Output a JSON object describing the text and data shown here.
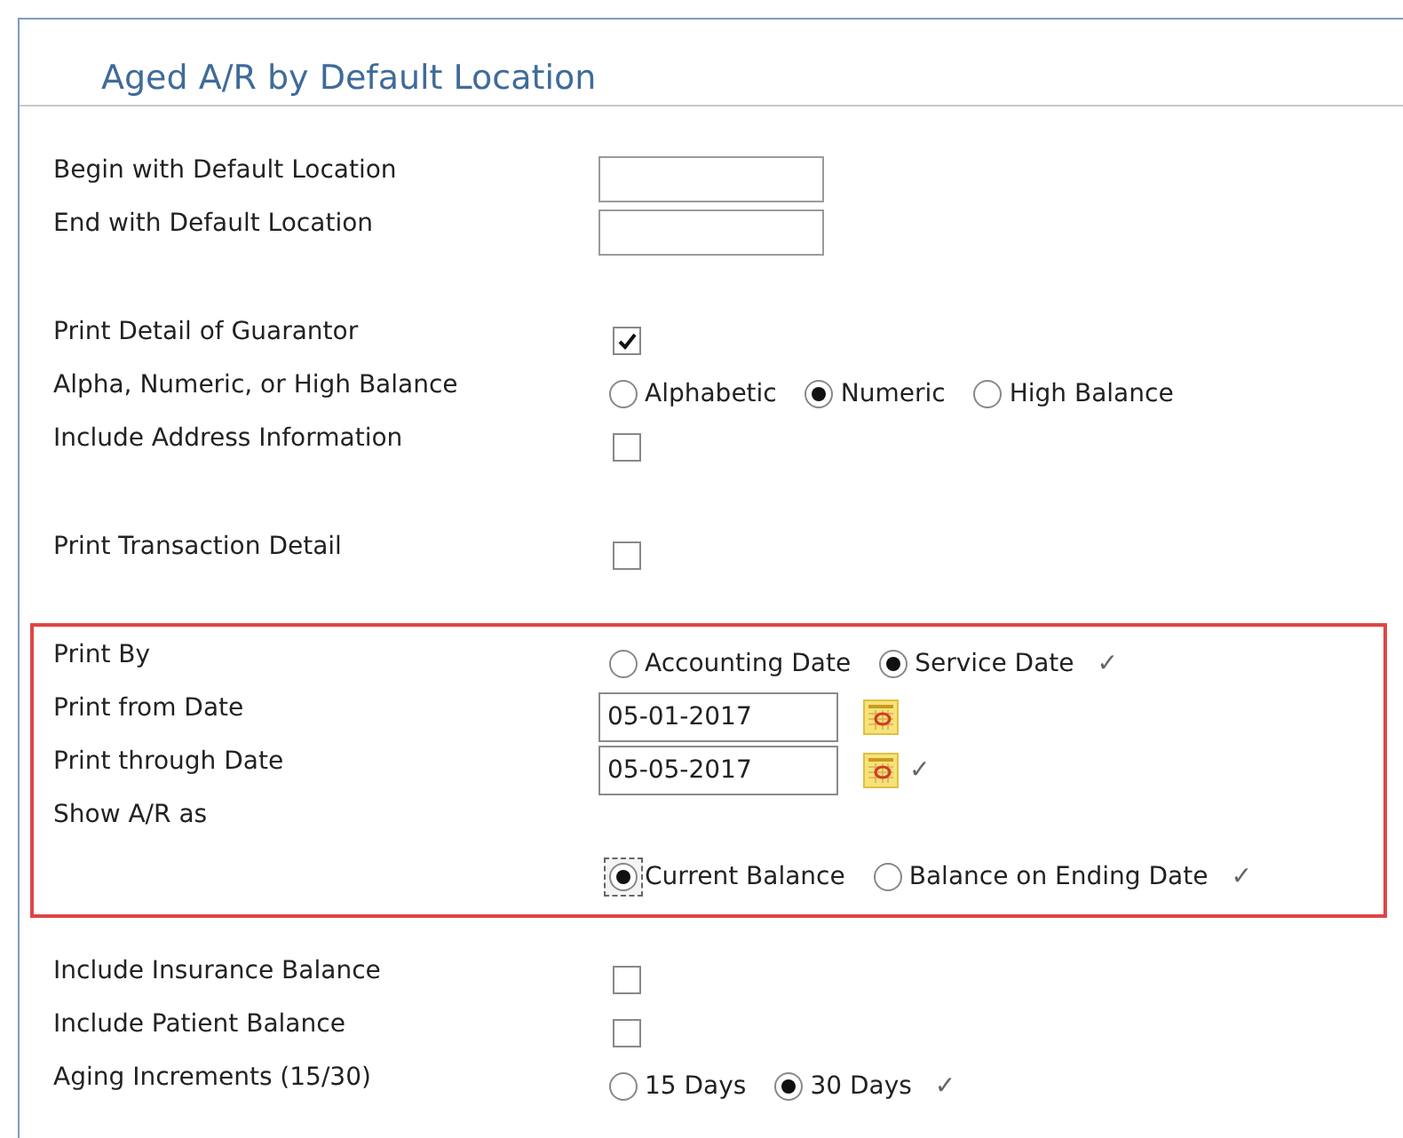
{
  "title": "Aged A/R by Default Location",
  "sections": [
    {
      "kind": "plain",
      "rows": [
        {
          "kind": "text",
          "label": "Begin with Default Location",
          "value": ""
        },
        {
          "kind": "text",
          "label": "End with Default Location",
          "value": ""
        }
      ]
    },
    {
      "kind": "plain",
      "rows": [
        {
          "kind": "checkbox",
          "label": "Print Detail of Guarantor",
          "checked": true
        },
        {
          "kind": "radio",
          "label": "Alpha, Numeric, or High Balance",
          "options": [
            {
              "label": "Alphabetic",
              "selected": false,
              "focused": false
            },
            {
              "label": "Numeric",
              "selected": true,
              "focused": false
            },
            {
              "label": "High Balance",
              "selected": false,
              "focused": false
            }
          ]
        },
        {
          "kind": "checkbox",
          "label": "Include Address Information",
          "checked": false
        }
      ]
    },
    {
      "kind": "plain",
      "rows": [
        {
          "kind": "checkbox",
          "label": "Print Transaction Detail",
          "checked": false
        }
      ]
    },
    {
      "kind": "highlighted",
      "rows": [
        {
          "kind": "radio",
          "label": "Print By",
          "options": [
            {
              "label": "Accounting Date",
              "selected": false,
              "focused": false
            },
            {
              "label": "Service Date",
              "selected": true,
              "focused": false
            }
          ],
          "mark": "✓"
        },
        {
          "kind": "date",
          "label": "Print from Date",
          "value": "05-01-2017"
        },
        {
          "kind": "date",
          "label": "Print through Date",
          "value": "05-05-2017",
          "mark": "✓"
        },
        {
          "kind": "radio",
          "label": "Show A/R as",
          "options": [
            {
              "label": "Current Balance",
              "selected": true,
              "focused": true
            },
            {
              "label": "Balance on Ending Date",
              "selected": false,
              "focused": false
            }
          ],
          "mark": "✓"
        }
      ]
    },
    {
      "kind": "plain",
      "rows": [
        {
          "kind": "checkbox",
          "label": "Include Insurance Balance",
          "checked": false
        },
        {
          "kind": "checkbox",
          "label": "Include Patient Balance",
          "checked": false
        },
        {
          "kind": "radio",
          "label": "Aging Increments (15/30)",
          "options": [
            {
              "label": "15 Days",
              "selected": false,
              "focused": false
            },
            {
              "label": "30 Days",
              "selected": true,
              "focused": false
            }
          ],
          "mark": "✓"
        }
      ]
    }
  ]
}
